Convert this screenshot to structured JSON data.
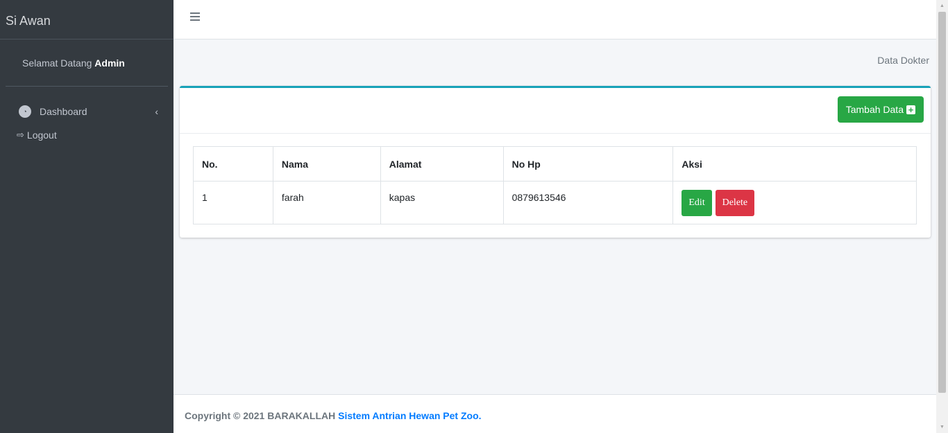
{
  "brand": "Si Awan",
  "user_panel": {
    "greeting": "Selamat Datang",
    "name": "Admin"
  },
  "nav": [
    {
      "label": "Dashboard",
      "icon": "tachometer-icon"
    },
    {
      "label": "Logout",
      "icon": "sign-out-icon"
    }
  ],
  "breadcrumb": "Data Dokter",
  "add_button": "Tambah Data",
  "table": {
    "headers": [
      "No.",
      "Nama",
      "Alamat",
      "No Hp",
      "Aksi"
    ],
    "rows": [
      {
        "no": "1",
        "nama": "farah",
        "alamat": "kapas",
        "nohp": "0879613546",
        "edit": "Edit",
        "delete": "Delete"
      }
    ]
  },
  "footer": {
    "prefix": "Copyright © 2021 BARAKALLAH",
    "link": "Sistem Antrian Hewan Pet Zoo."
  },
  "colors": {
    "sidebar": "#343a40",
    "card_accent": "#17a2b8",
    "success": "#28a745",
    "danger": "#dc3545",
    "link": "#007bff"
  }
}
